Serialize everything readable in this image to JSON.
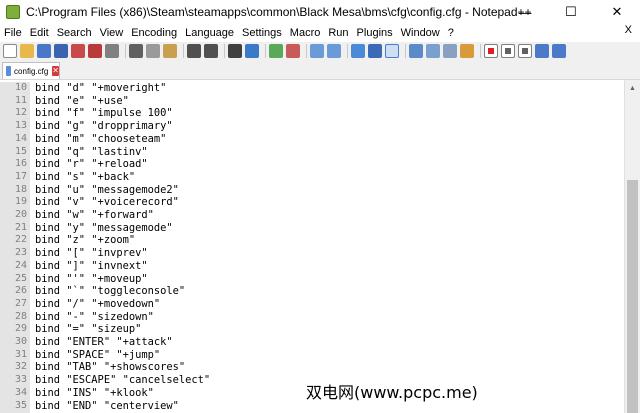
{
  "window": {
    "title": "C:\\Program Files (x86)\\Steam\\steamapps\\common\\Black Mesa\\bms\\cfg\\config.cfg - Notepad++",
    "minimize_glyph": "—",
    "maximize_glyph": "☐",
    "close_glyph": "✕"
  },
  "menu": {
    "items": [
      "File",
      "Edit",
      "Search",
      "View",
      "Encoding",
      "Language",
      "Settings",
      "Macro",
      "Run",
      "Plugins",
      "Window",
      "?"
    ],
    "close_glyph": "X"
  },
  "toolbar": {
    "icons": [
      "new-file-icon",
      "open-file-icon",
      "save-icon",
      "save-all-icon",
      "close-icon",
      "close-all-icon",
      "print-icon",
      "cut-icon",
      "copy-icon",
      "paste-icon",
      "undo-icon",
      "redo-icon",
      "find-icon",
      "replace-icon",
      "zoom-in-icon",
      "zoom-out-icon",
      "sync-vertical-icon",
      "sync-horizontal-icon",
      "word-wrap-icon",
      "show-all-chars-icon",
      "indent-guide-icon",
      "user-lang-icon",
      "doc-map-icon",
      "function-list-icon",
      "folder-workspace-icon",
      "record-macro-icon",
      "stop-record-icon",
      "playback-macro-icon",
      "run-multiple-icon",
      "save-macro-icon"
    ]
  },
  "tab": {
    "label": "config.cfg",
    "close_glyph": "✕"
  },
  "editor": {
    "lines": [
      {
        "num": "10",
        "text": "bind \"d\" \"+moveright\""
      },
      {
        "num": "11",
        "text": "bind \"e\" \"+use\""
      },
      {
        "num": "12",
        "text": "bind \"f\" \"impulse 100\""
      },
      {
        "num": "13",
        "text": "bind \"g\" \"dropprimary\""
      },
      {
        "num": "14",
        "text": "bind \"m\" \"chooseteam\""
      },
      {
        "num": "15",
        "text": "bind \"q\" \"lastinv\""
      },
      {
        "num": "16",
        "text": "bind \"r\" \"+reload\""
      },
      {
        "num": "17",
        "text": "bind \"s\" \"+back\""
      },
      {
        "num": "18",
        "text": "bind \"u\" \"messagemode2\""
      },
      {
        "num": "19",
        "text": "bind \"v\" \"+voicerecord\""
      },
      {
        "num": "20",
        "text": "bind \"w\" \"+forward\""
      },
      {
        "num": "21",
        "text": "bind \"y\" \"messagemode\""
      },
      {
        "num": "22",
        "text": "bind \"z\" \"+zoom\""
      },
      {
        "num": "23",
        "text": "bind \"[\" \"invprev\""
      },
      {
        "num": "24",
        "text": "bind \"]\" \"invnext\""
      },
      {
        "num": "25",
        "text": "bind \"'\" \"+moveup\""
      },
      {
        "num": "26",
        "text": "bind \"`\" \"toggleconsole\""
      },
      {
        "num": "27",
        "text": "bind \"/\" \"+movedown\""
      },
      {
        "num": "28",
        "text": "bind \"-\" \"sizedown\""
      },
      {
        "num": "29",
        "text": "bind \"=\" \"sizeup\""
      },
      {
        "num": "30",
        "text": "bind \"ENTER\" \"+attack\""
      },
      {
        "num": "31",
        "text": "bind \"SPACE\" \"+jump\""
      },
      {
        "num": "32",
        "text": "bind \"TAB\" \"+showscores\""
      },
      {
        "num": "33",
        "text": "bind \"ESCAPE\" \"cancelselect\""
      },
      {
        "num": "34",
        "text": "bind \"INS\" \"+klook\""
      },
      {
        "num": "35",
        "text": "bind \"END\" \"centerview\""
      }
    ]
  },
  "watermark": "双电网(www.pcpc.me)",
  "colors": {
    "gutter_bg": "#e4e4e4",
    "line_number": "#808080",
    "toolbar_bg": "#f0f0f0"
  }
}
